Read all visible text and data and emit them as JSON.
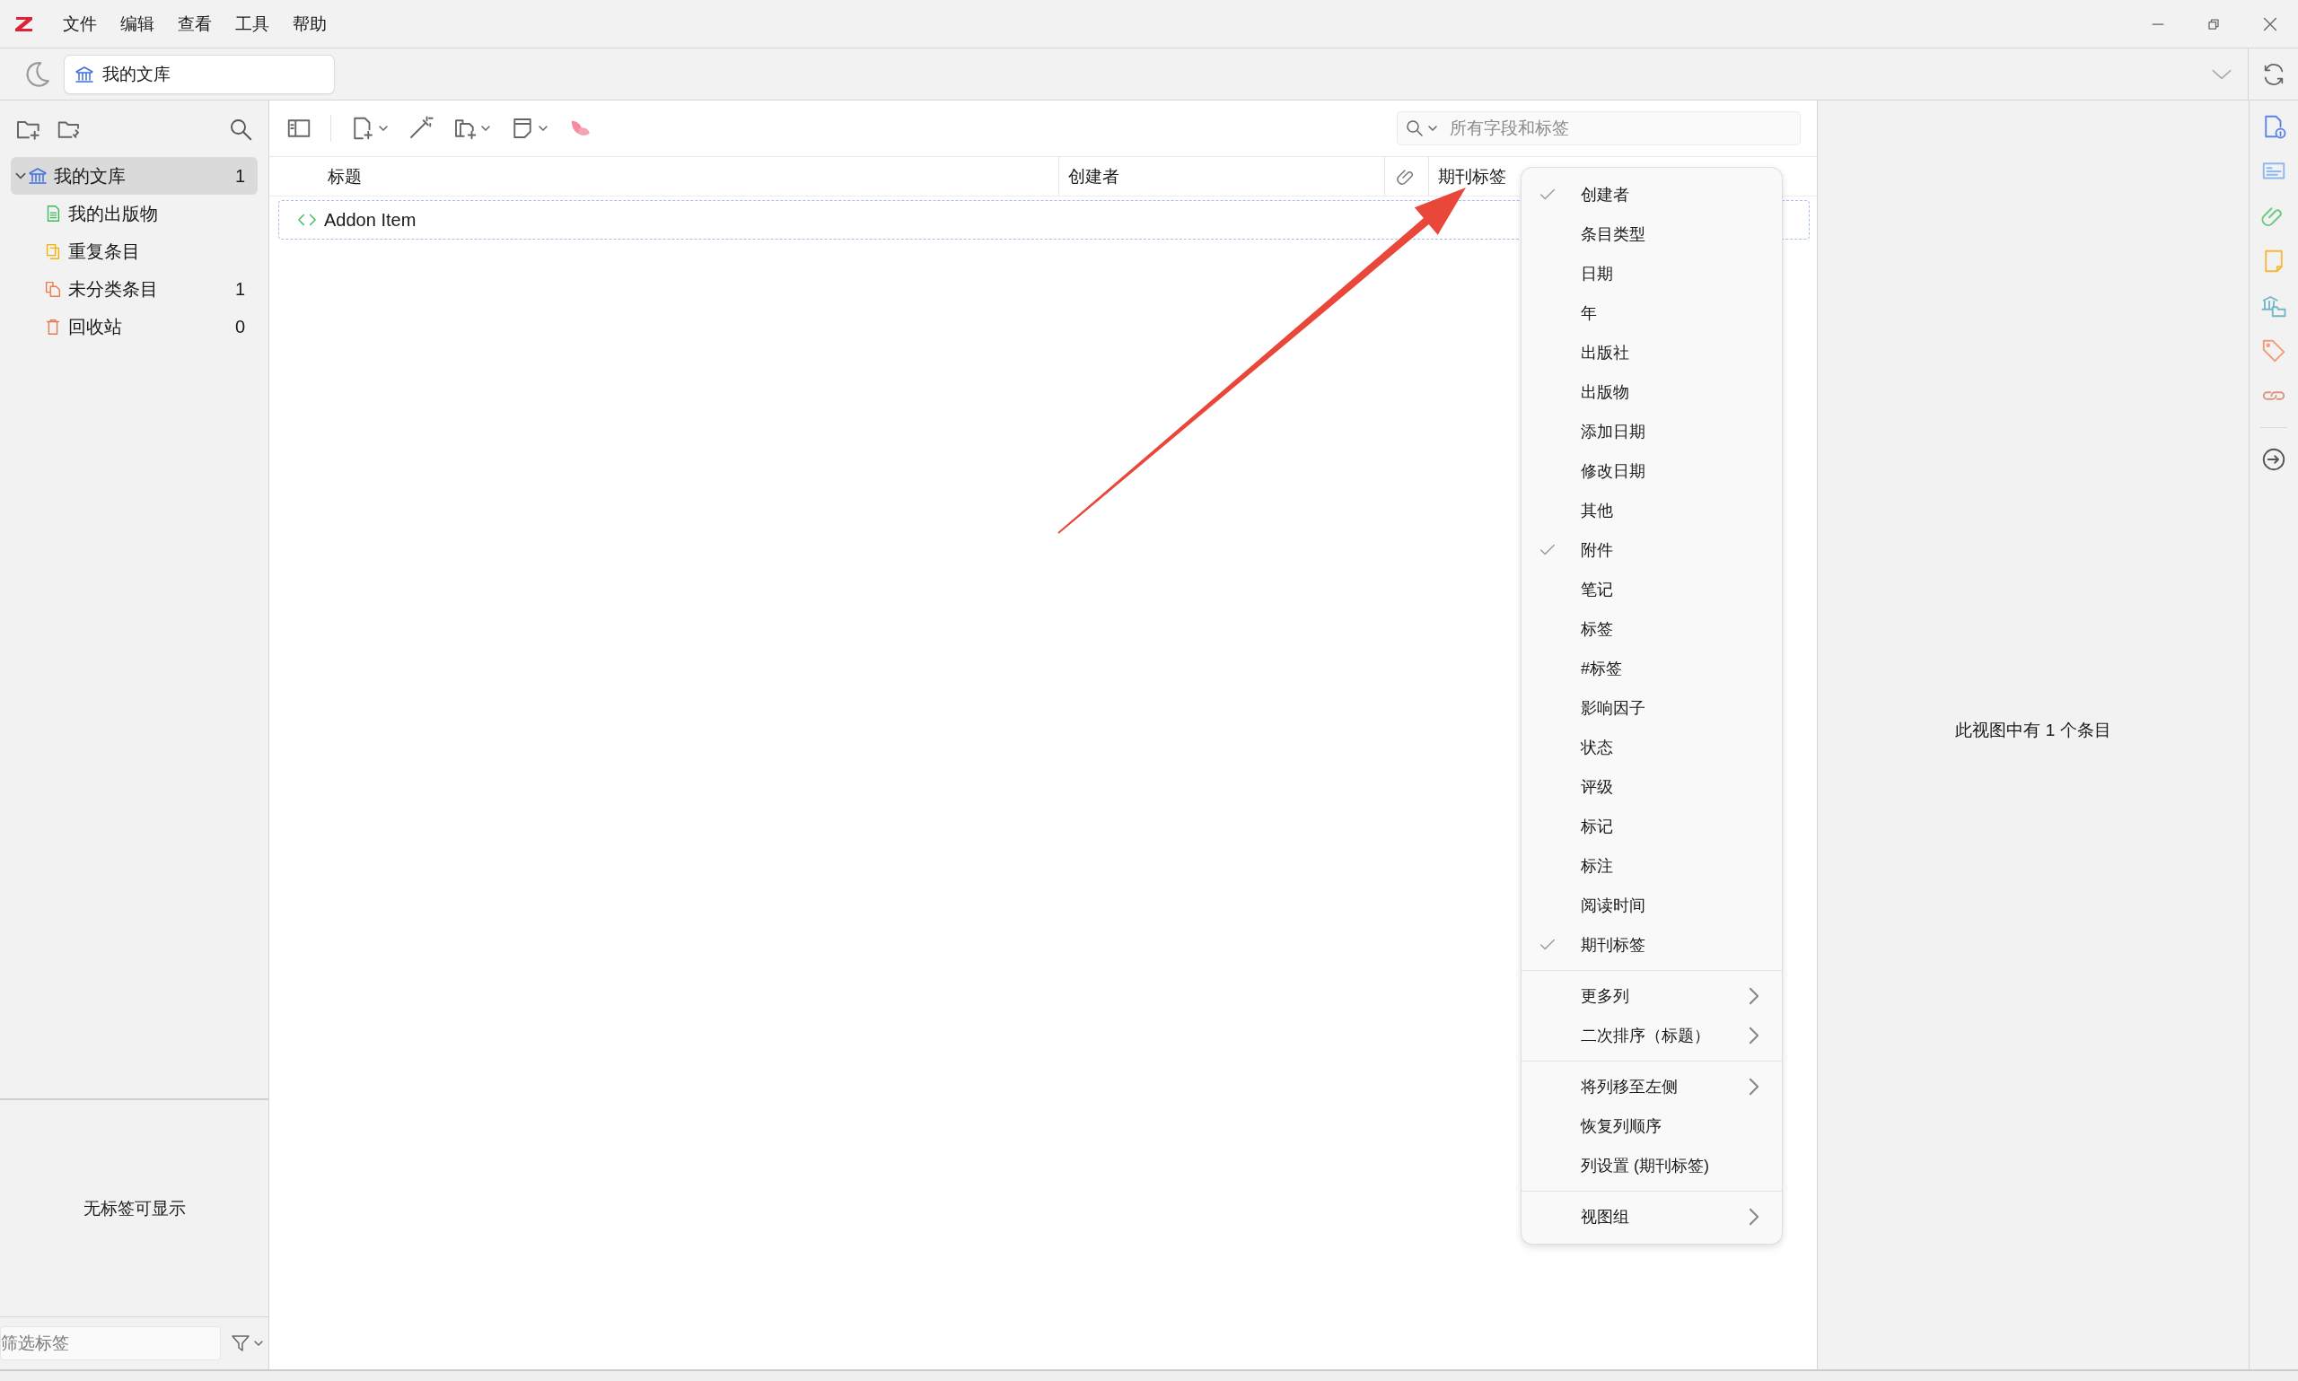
{
  "menubar": {
    "items": [
      "文件",
      "编辑",
      "查看",
      "工具",
      "帮助"
    ]
  },
  "location": {
    "label": "我的文库"
  },
  "collections": [
    {
      "label": "我的文库",
      "count": "1",
      "kind": "library",
      "selected": true,
      "expanded": true,
      "children": [
        {
          "label": "我的出版物",
          "kind": "publications",
          "selected": false
        },
        {
          "label": "重复条目",
          "kind": "duplicates",
          "selected": false
        },
        {
          "label": "未分类条目",
          "count": "1",
          "kind": "unfiled",
          "selected": false
        },
        {
          "label": "回收站",
          "count": "0",
          "kind": "trash",
          "selected": false
        }
      ]
    }
  ],
  "tag_pane": {
    "message": "无标签可显示",
    "filter": {
      "placeholder": "筛选标签"
    }
  },
  "search": {
    "placeholder": "所有字段和标签"
  },
  "columns": [
    {
      "label": "标题",
      "kind": "text"
    },
    {
      "label": "创建者",
      "kind": "text"
    },
    {
      "kind": "attachment"
    },
    {
      "label": "期刊标签",
      "kind": "text"
    }
  ],
  "items": [
    {
      "title": "Addon Item"
    }
  ],
  "item_pane": {
    "message": "此视图中有 1 个条目"
  },
  "context_menu": {
    "groups": [
      [
        {
          "label": "创建者",
          "checked": true
        },
        {
          "label": "条目类型",
          "checked": false
        },
        {
          "label": "日期",
          "checked": false
        },
        {
          "label": "年",
          "checked": false
        },
        {
          "label": "出版社",
          "checked": false
        },
        {
          "label": "出版物",
          "checked": false
        },
        {
          "label": "添加日期",
          "checked": false
        },
        {
          "label": "修改日期",
          "checked": false
        },
        {
          "label": "其他",
          "checked": false
        },
        {
          "label": "附件",
          "checked": true
        },
        {
          "label": "笔记",
          "checked": false
        },
        {
          "label": "标签",
          "checked": false
        },
        {
          "label": "#标签",
          "checked": false
        },
        {
          "label": "影响因子",
          "checked": false
        },
        {
          "label": "状态",
          "checked": false
        },
        {
          "label": "评级",
          "checked": false
        },
        {
          "label": "标记",
          "checked": false
        },
        {
          "label": "标注",
          "checked": false
        },
        {
          "label": "阅读时间",
          "checked": false
        },
        {
          "label": "期刊标签",
          "checked": true
        }
      ],
      [
        {
          "label": "更多列",
          "submenu": true
        },
        {
          "label": "二次排序（标题）",
          "submenu": true
        }
      ],
      [
        {
          "label": "将列移至左侧",
          "submenu": true
        },
        {
          "label": "恢复列顺序",
          "submenu": false
        },
        {
          "label": "列设置 (期刊标签)",
          "submenu": false
        }
      ],
      [
        {
          "label": "视图组",
          "submenu": true
        }
      ]
    ]
  }
}
